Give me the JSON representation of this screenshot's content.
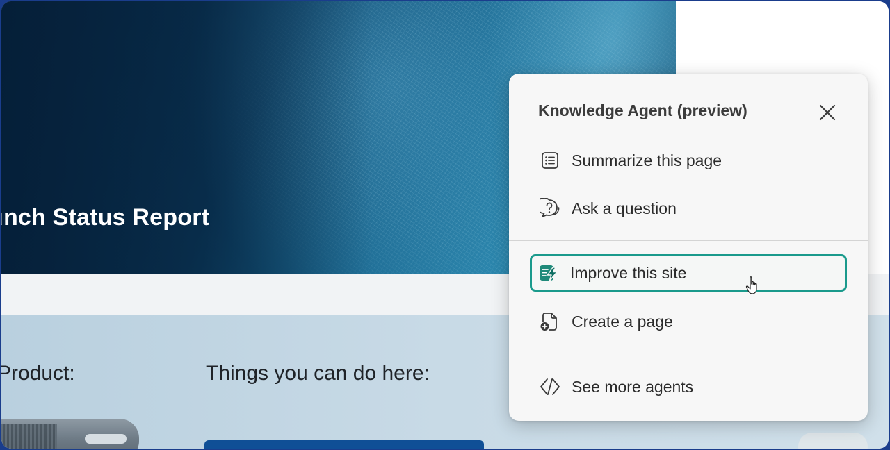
{
  "hero": {
    "title": "unch Status Report"
  },
  "content": {
    "heading_product": "Product:",
    "heading_things": "Things you can do here:"
  },
  "panel": {
    "title": "Knowledge Agent (preview)",
    "close_icon": "close-icon",
    "items": [
      {
        "label": "Summarize this page",
        "icon": "list-icon"
      },
      {
        "label": "Ask a question",
        "icon": "question-chat-icon"
      },
      {
        "label": "Improve this site",
        "icon": "improve-site-icon",
        "highlighted": true
      },
      {
        "label": "Create a page",
        "icon": "add-page-icon"
      },
      {
        "label": "See more agents",
        "icon": "code-diamond-icon"
      }
    ]
  },
  "colors": {
    "highlight_border": "#1a9a8c",
    "improve_icon": "#0f7d70",
    "hero_dark": "#0a2f4f",
    "button_blue": "#0f4f96",
    "frame_border": "#1a3d8c"
  }
}
